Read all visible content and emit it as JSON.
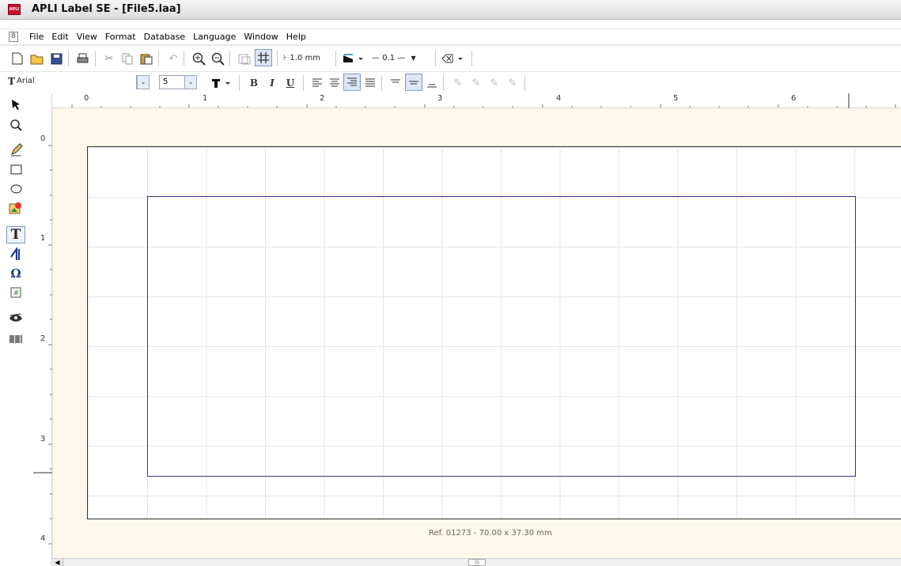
{
  "window": {
    "title": "APLI Label SE - [File5.laa]",
    "app_icon_text": "APLI"
  },
  "menu": {
    "doc_icon": "8",
    "items": [
      "File",
      "Edit",
      "View",
      "Format",
      "Database",
      "Language",
      "Window",
      "Help"
    ]
  },
  "toolbar1": {
    "grid_size": "1.0 mm",
    "line_width": "— 0.1 —"
  },
  "toolbar2": {
    "font_name": "Arial",
    "font_size": "5",
    "bold": "B",
    "italic": "I",
    "underline": "U"
  },
  "ruler_top": [
    "0",
    "1",
    "2",
    "3",
    "4",
    "5",
    "6"
  ],
  "ruler_left": [
    "0",
    "1",
    "2",
    "3",
    "4"
  ],
  "label_ref": "Ref. 01273 - 70.00 x 37.30 mm",
  "tools": [
    "pointer-icon",
    "zoom-icon",
    "pencil-icon",
    "rectangle-icon",
    "ellipse-icon",
    "image-icon",
    "text-icon",
    "curved-text-icon",
    "symbol-icon",
    "counter-icon",
    "eye-icon",
    "barcode-icon"
  ],
  "colors": {
    "canvas_bg": "#fdf8e9",
    "label_border": "#3b3b8f",
    "selection": "#7c9bc9"
  }
}
